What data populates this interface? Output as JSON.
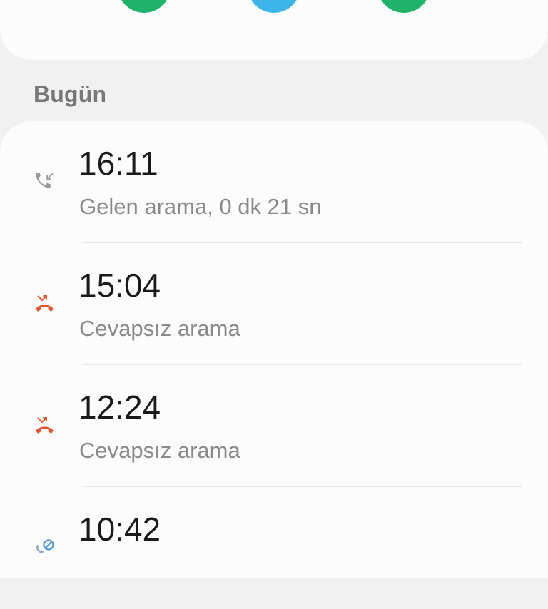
{
  "actions": [
    {
      "icon": "phone-icon",
      "color": "#1fb36a"
    },
    {
      "icon": "message-icon",
      "color": "#3db4e8"
    },
    {
      "icon": "video-icon",
      "color": "#1fb36a"
    }
  ],
  "section_header": "Bugün",
  "calls": [
    {
      "time": "16:11",
      "description": "Gelen arama, 0 dk 21 sn",
      "type": "incoming",
      "icon": "incoming-call-icon",
      "icon_color": "#9a9a9a"
    },
    {
      "time": "15:04",
      "description": "Cevapsız arama",
      "type": "missed",
      "icon": "missed-call-icon",
      "icon_color": "#e0552f"
    },
    {
      "time": "12:24",
      "description": "Cevapsız arama",
      "type": "missed",
      "icon": "missed-call-icon",
      "icon_color": "#e0552f"
    },
    {
      "time": "10:42",
      "description": "",
      "type": "blocked",
      "icon": "blocked-call-icon",
      "icon_color": "#4e97d8"
    }
  ]
}
